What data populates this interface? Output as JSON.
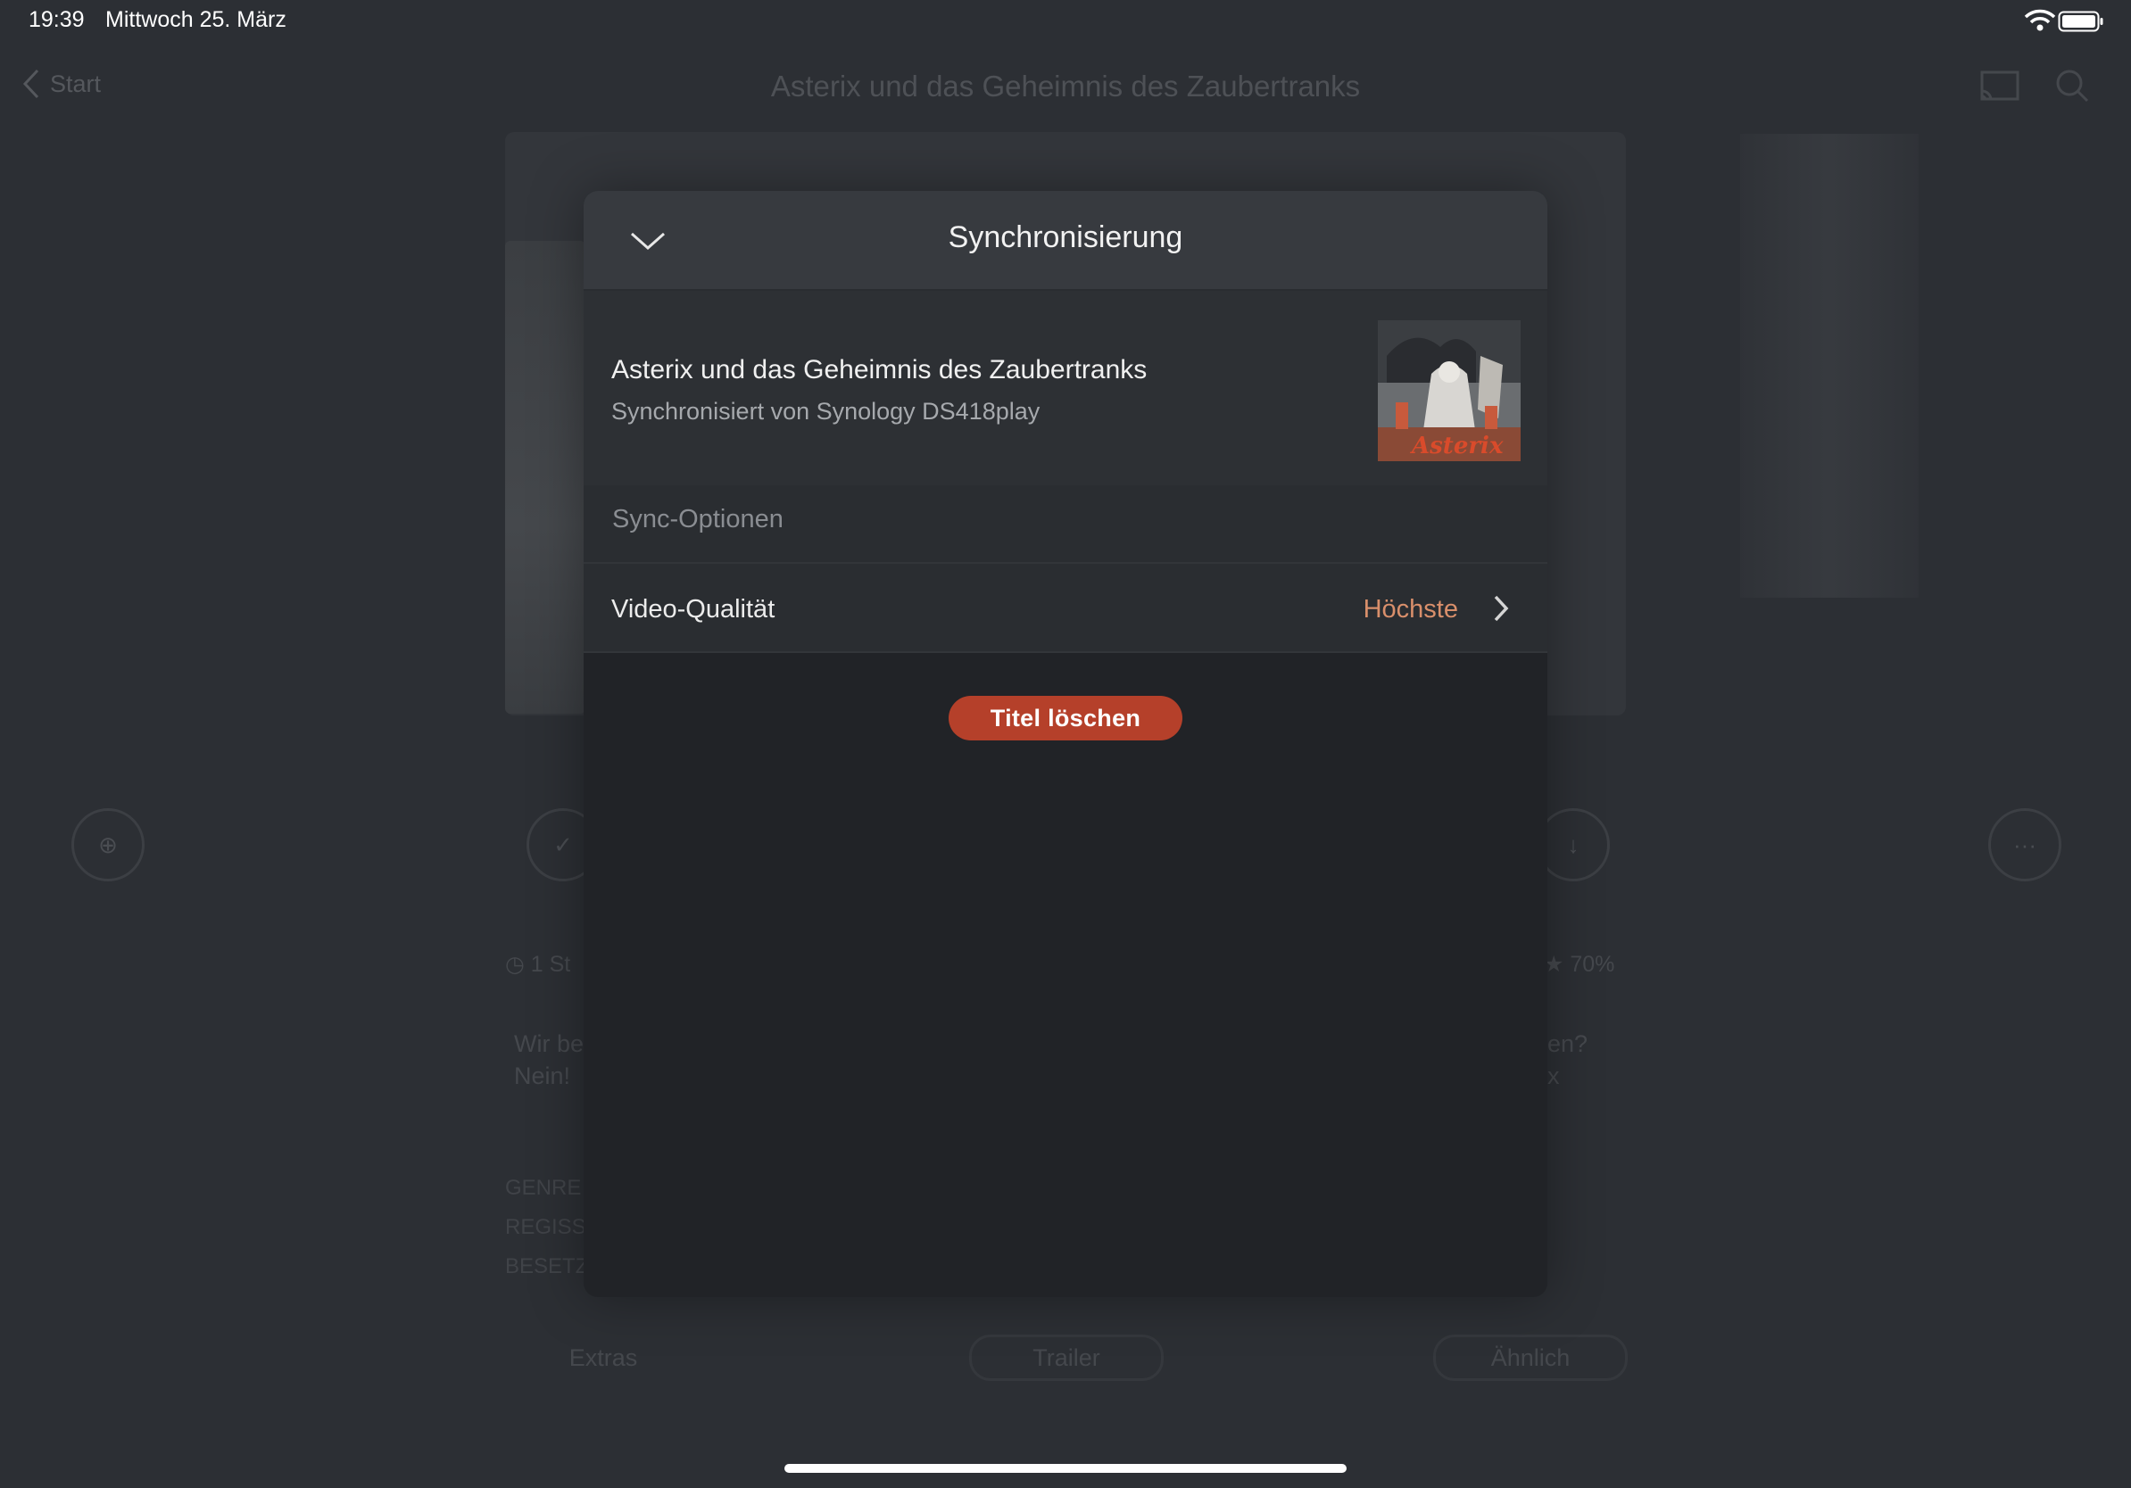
{
  "status_bar": {
    "time": "19:39",
    "date": "Mittwoch 25. März"
  },
  "background": {
    "back_label": "Start",
    "title": "Asterix und das Geheimnis des Zaubertranks",
    "meta_left": "1 St",
    "meta_right": "70%",
    "desc_left_1": "Wir be",
    "desc_left_2": "Nein! ",
    "desc_right_1": "en?",
    "desc_right_2": "x",
    "label_genre": "GENRE",
    "label_regie": "REGISS",
    "label_besetzung": "BESETZ",
    "tab_extras": "Extras",
    "tab_trailer": "Trailer",
    "tab_similar": "Ähnlich"
  },
  "modal": {
    "title": "Synchronisierung",
    "item": {
      "title": "Asterix und das Geheimnis des Zaubertranks",
      "subtitle": "Synchronisiert von Synology DS418play",
      "thumb_text": "Asterix"
    },
    "section_label": "Sync-Optionen",
    "quality": {
      "label": "Video-Qualität",
      "value": "Höchste"
    },
    "delete_label": "Titel löschen"
  },
  "colors": {
    "accent": "#d98f6b",
    "danger": "#b5402a",
    "modal_bg": "#212327",
    "header_bg": "#373a3f"
  }
}
